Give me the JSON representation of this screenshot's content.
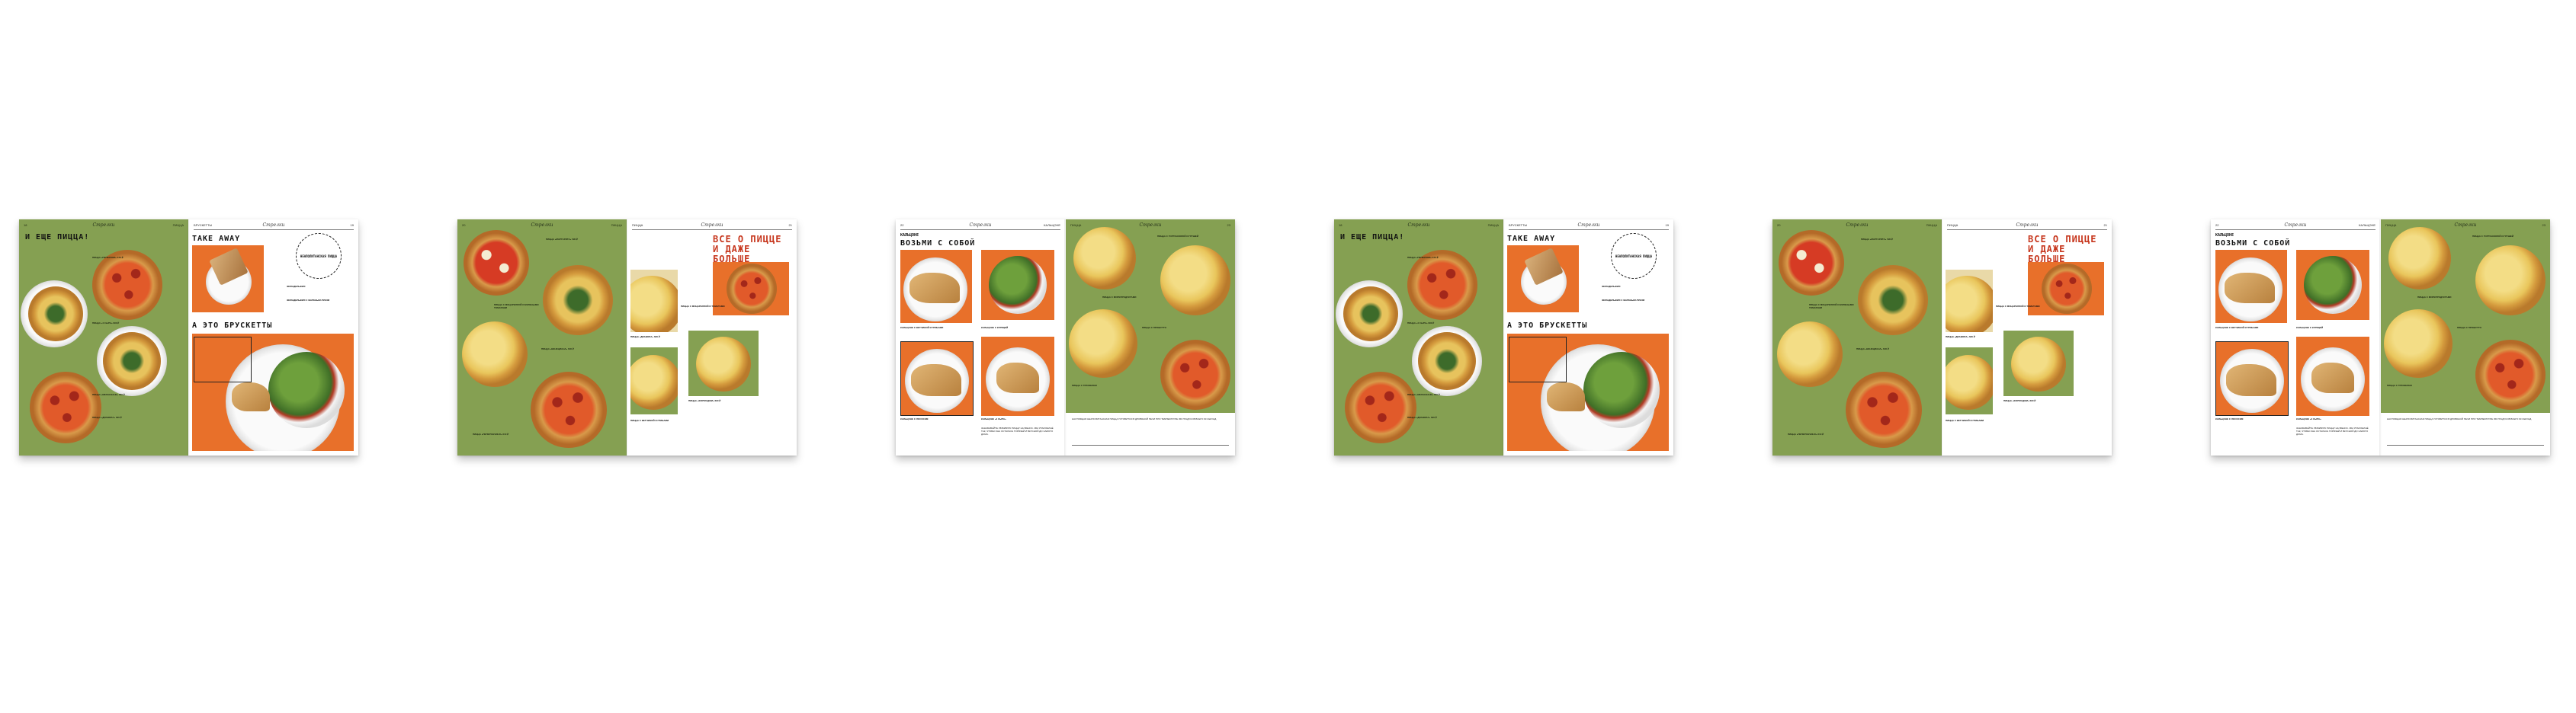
{
  "colors": {
    "green": "#85a052",
    "orange": "#e8702a",
    "red_title": "#c7371e",
    "background": "#ffffff"
  },
  "brand": "Стрелки",
  "spreads": [
    {
      "left": {
        "num": "18",
        "section": "ПИЦЦА",
        "title": "И ЕЩЕ ПИЦЦА!",
        "items": [
          "ПИЦЦА «ПЕПЕРОНИ» 670 ₽",
          "ПИЦЦА «4 СЫРА» 690 ₽",
          "ПИЦЦА «МЕЛАНЗАНЕ» 650 ₽",
          "ПИЦЦА «ДИАВОЛА» 620 ₽"
        ]
      },
      "right": {
        "num": "19",
        "section": "БРУСКЕТТЫ",
        "title": "TAKE AWAY",
        "title2": "А ЭТО БРУСКЕТТЫ",
        "stamp": "НЕАПОЛИТАНСКАЯ ПИЦЦА",
        "items": [
          "ФИЛАДЕЛЬФИЯ",
          "ФИЛАДЕЛЬФИЯ С ЖАРЕНЫМ ЛУКОМ"
        ]
      }
    },
    {
      "left": {
        "num": "20",
        "section": "ПИЦЦА",
        "items": [
          "ПИЦЦА «МАРГАРИТА» 590 ₽",
          "ПИЦЦА С МОЦАРЕЛЛОЙ И ВЯЛЕНЫМИ ТОМАТАМИ",
          "ПИЦЦА «ВЕНЕЦИАНА» 640 ₽",
          "ПИЦЦА «ПЕПЕРОНЧИНО» 610 ₽"
        ]
      },
      "right": {
        "num": "21",
        "section": "ПИЦЦА",
        "title": "ВСЕ О ПИЦЦЕ И ДАЖЕ БОЛЬШЕ",
        "items": [
          "ПИЦЦА С МОЦАРЕЛЛОЙ И ТОМАТАМИ",
          "ПИЦЦА «ДИАВОЛА» 620 ₽",
          "ПИЦЦА «ФОРМАДЖИ» 690 ₽",
          "ПИЦЦА С ВЕТЧИНОЙ И ГРИБАМИ"
        ]
      }
    },
    {
      "left": {
        "num": "22",
        "section": "КАЛЬЦОНЕ",
        "title": "ВОЗЬМИ С СОБОЙ",
        "items": [
          "КАЛЬЦОНЕ С ВЕТЧИНОЙ И ГРИБАМИ",
          "КАЛЬЦОНЕ С КУРИЦЕЙ",
          "КАЛЬЦОНЕ «4 СЫРА»",
          "КАЛЬЦОНЕ С ЛОСОСЕМ"
        ],
        "paragraph": "ЗАКАЗЫВАЙТЕ ЛЮБИМУЮ ПИЦЦУ НА ВЫНОС. МЫ УПАКУЕМ ЕЁ ТАК, ЧТОБЫ ОНА ОСТАЛАСЬ ГОРЯЧЕЙ И ВКУСНОЙ ДО САМОГО ДОМА."
      },
      "right": {
        "num": "23",
        "section": "ПИЦЦА",
        "items": [
          "ПИЦЦА С ГОРГОНЗОЛОЙ И ГРУШЕЙ",
          "ПИЦЦА С МОРЕПРОДУКТАМИ",
          "ПИЦЦА С ПРОШУТТО",
          "ПИЦЦА С ТРЮФЕЛЕМ"
        ],
        "paragraph": "НАСТОЯЩАЯ НЕАПОЛИТАНСКАЯ ПИЦЦА ГОТОВИТСЯ В ДРОВЯНОЙ ПЕЧИ ПРИ ТЕМПЕРАТУРЕ 450 ГРАДУСОВ ВСЕГО 90 СЕКУНД."
      }
    }
  ]
}
